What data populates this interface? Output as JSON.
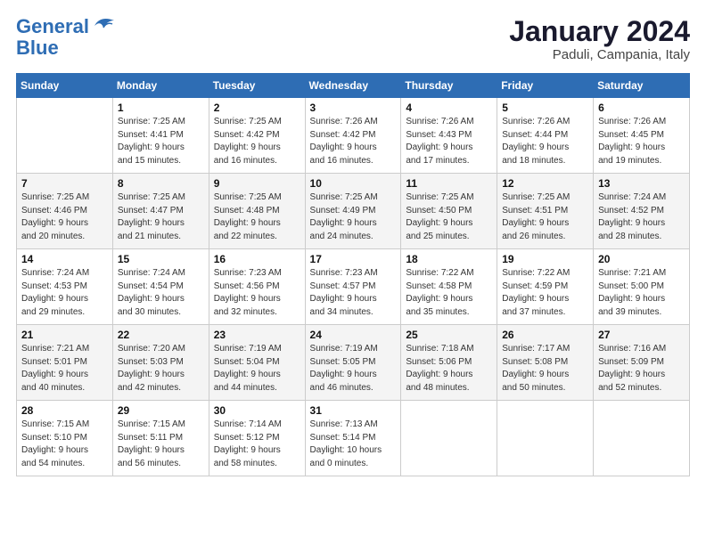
{
  "logo": {
    "line1": "General",
    "line2": "Blue"
  },
  "title": "January 2024",
  "location": "Paduli, Campania, Italy",
  "days_header": [
    "Sunday",
    "Monday",
    "Tuesday",
    "Wednesday",
    "Thursday",
    "Friday",
    "Saturday"
  ],
  "weeks": [
    [
      {
        "num": "",
        "info": ""
      },
      {
        "num": "1",
        "info": "Sunrise: 7:25 AM\nSunset: 4:41 PM\nDaylight: 9 hours\nand 15 minutes."
      },
      {
        "num": "2",
        "info": "Sunrise: 7:25 AM\nSunset: 4:42 PM\nDaylight: 9 hours\nand 16 minutes."
      },
      {
        "num": "3",
        "info": "Sunrise: 7:26 AM\nSunset: 4:42 PM\nDaylight: 9 hours\nand 16 minutes."
      },
      {
        "num": "4",
        "info": "Sunrise: 7:26 AM\nSunset: 4:43 PM\nDaylight: 9 hours\nand 17 minutes."
      },
      {
        "num": "5",
        "info": "Sunrise: 7:26 AM\nSunset: 4:44 PM\nDaylight: 9 hours\nand 18 minutes."
      },
      {
        "num": "6",
        "info": "Sunrise: 7:26 AM\nSunset: 4:45 PM\nDaylight: 9 hours\nand 19 minutes."
      }
    ],
    [
      {
        "num": "7",
        "info": "Sunrise: 7:25 AM\nSunset: 4:46 PM\nDaylight: 9 hours\nand 20 minutes."
      },
      {
        "num": "8",
        "info": "Sunrise: 7:25 AM\nSunset: 4:47 PM\nDaylight: 9 hours\nand 21 minutes."
      },
      {
        "num": "9",
        "info": "Sunrise: 7:25 AM\nSunset: 4:48 PM\nDaylight: 9 hours\nand 22 minutes."
      },
      {
        "num": "10",
        "info": "Sunrise: 7:25 AM\nSunset: 4:49 PM\nDaylight: 9 hours\nand 24 minutes."
      },
      {
        "num": "11",
        "info": "Sunrise: 7:25 AM\nSunset: 4:50 PM\nDaylight: 9 hours\nand 25 minutes."
      },
      {
        "num": "12",
        "info": "Sunrise: 7:25 AM\nSunset: 4:51 PM\nDaylight: 9 hours\nand 26 minutes."
      },
      {
        "num": "13",
        "info": "Sunrise: 7:24 AM\nSunset: 4:52 PM\nDaylight: 9 hours\nand 28 minutes."
      }
    ],
    [
      {
        "num": "14",
        "info": "Sunrise: 7:24 AM\nSunset: 4:53 PM\nDaylight: 9 hours\nand 29 minutes."
      },
      {
        "num": "15",
        "info": "Sunrise: 7:24 AM\nSunset: 4:54 PM\nDaylight: 9 hours\nand 30 minutes."
      },
      {
        "num": "16",
        "info": "Sunrise: 7:23 AM\nSunset: 4:56 PM\nDaylight: 9 hours\nand 32 minutes."
      },
      {
        "num": "17",
        "info": "Sunrise: 7:23 AM\nSunset: 4:57 PM\nDaylight: 9 hours\nand 34 minutes."
      },
      {
        "num": "18",
        "info": "Sunrise: 7:22 AM\nSunset: 4:58 PM\nDaylight: 9 hours\nand 35 minutes."
      },
      {
        "num": "19",
        "info": "Sunrise: 7:22 AM\nSunset: 4:59 PM\nDaylight: 9 hours\nand 37 minutes."
      },
      {
        "num": "20",
        "info": "Sunrise: 7:21 AM\nSunset: 5:00 PM\nDaylight: 9 hours\nand 39 minutes."
      }
    ],
    [
      {
        "num": "21",
        "info": "Sunrise: 7:21 AM\nSunset: 5:01 PM\nDaylight: 9 hours\nand 40 minutes."
      },
      {
        "num": "22",
        "info": "Sunrise: 7:20 AM\nSunset: 5:03 PM\nDaylight: 9 hours\nand 42 minutes."
      },
      {
        "num": "23",
        "info": "Sunrise: 7:19 AM\nSunset: 5:04 PM\nDaylight: 9 hours\nand 44 minutes."
      },
      {
        "num": "24",
        "info": "Sunrise: 7:19 AM\nSunset: 5:05 PM\nDaylight: 9 hours\nand 46 minutes."
      },
      {
        "num": "25",
        "info": "Sunrise: 7:18 AM\nSunset: 5:06 PM\nDaylight: 9 hours\nand 48 minutes."
      },
      {
        "num": "26",
        "info": "Sunrise: 7:17 AM\nSunset: 5:08 PM\nDaylight: 9 hours\nand 50 minutes."
      },
      {
        "num": "27",
        "info": "Sunrise: 7:16 AM\nSunset: 5:09 PM\nDaylight: 9 hours\nand 52 minutes."
      }
    ],
    [
      {
        "num": "28",
        "info": "Sunrise: 7:15 AM\nSunset: 5:10 PM\nDaylight: 9 hours\nand 54 minutes."
      },
      {
        "num": "29",
        "info": "Sunrise: 7:15 AM\nSunset: 5:11 PM\nDaylight: 9 hours\nand 56 minutes."
      },
      {
        "num": "30",
        "info": "Sunrise: 7:14 AM\nSunset: 5:12 PM\nDaylight: 9 hours\nand 58 minutes."
      },
      {
        "num": "31",
        "info": "Sunrise: 7:13 AM\nSunset: 5:14 PM\nDaylight: 10 hours\nand 0 minutes."
      },
      {
        "num": "",
        "info": ""
      },
      {
        "num": "",
        "info": ""
      },
      {
        "num": "",
        "info": ""
      }
    ]
  ]
}
